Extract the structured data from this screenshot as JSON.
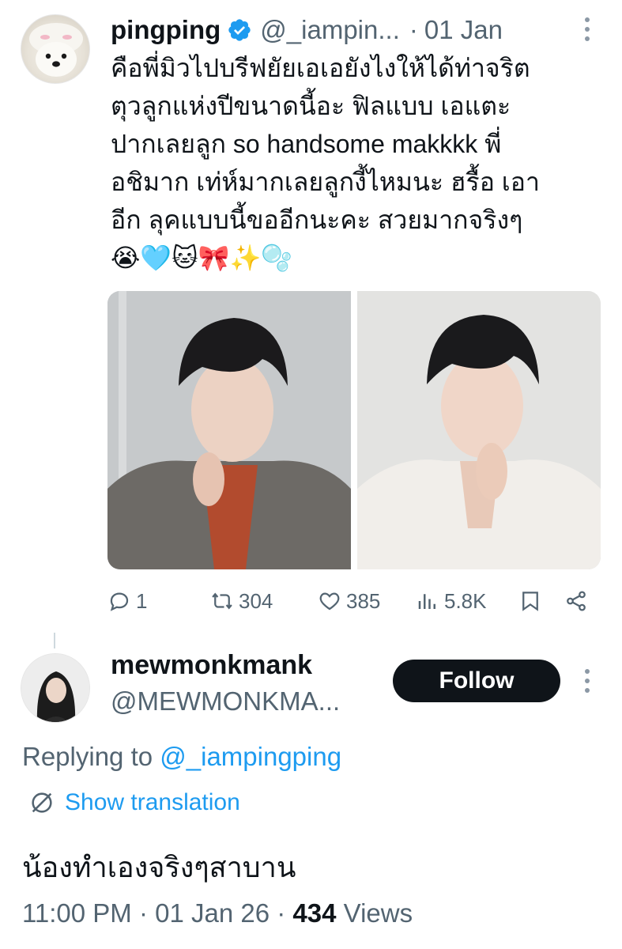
{
  "tweet": {
    "display_name": "pingping",
    "handle": "@_iampin...",
    "date": "01 Jan",
    "text": "คือพี่มิวไปบรีฟยัยเอเอยังไงให้ได้ท่าจริต\nตุวลูกแห่งปีขนาดนี้อะ ฟิลแบบ เอแตะ\nปากเลยลูก so handsome makkkk พี่\nอชิมาก เท่ห์มากเลยลูกงี้ไหมนะ ฮรื้อ เอา\nอีก ลุคแบบนี้ขออีกนะคะ สวยมากจริงๆ\n😭🩵🐱🎀✨🫧",
    "stats": {
      "replies": "1",
      "retweets": "304",
      "likes": "385",
      "views": "5.8K"
    }
  },
  "reply": {
    "display_name": "mewmonkmank",
    "handle": "@MEWMONKMA...",
    "follow_label": "Follow",
    "replying_prefix": "Replying to ",
    "replying_to": "@_iampingping",
    "show_translation": "Show translation",
    "text": "น้องทำเองจริงๆสาบาน",
    "time": "11:00 PM · 01 Jan 26 · ",
    "views_count": "434",
    "views_label": " Views"
  },
  "colors": {
    "accent": "#1d9bf0",
    "muted": "#536471",
    "text": "#0f1419"
  },
  "icons": [
    "verified-badge-icon",
    "more-icon",
    "reply-icon",
    "retweet-icon",
    "like-icon",
    "views-icon",
    "bookmark-icon",
    "share-icon",
    "translate-icon"
  ]
}
